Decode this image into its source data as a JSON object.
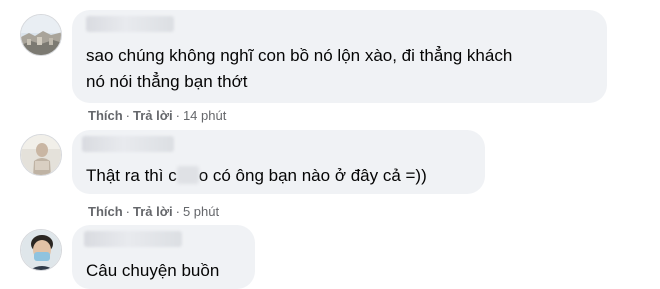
{
  "comments": [
    {
      "text_line1": "sao chúng không nghĩ con bồ nó lộn xào, đi thẳng khách",
      "text_line2": "nó nói thẳng bạn thớt",
      "like_label": "Thích",
      "reply_label": "Trả lời",
      "time": "14 phút"
    },
    {
      "text_before": "Thật ra thì c",
      "text_after": "o có ông bạn nào ở đây cả =))",
      "like_label": "Thích",
      "reply_label": "Trả lời",
      "time": "5 phút"
    },
    {
      "text": "Câu chuyện buồn"
    }
  ],
  "separator": "·",
  "colors": {
    "bubble": "#f0f2f5",
    "meta": "#65676b",
    "text": "#050505"
  }
}
